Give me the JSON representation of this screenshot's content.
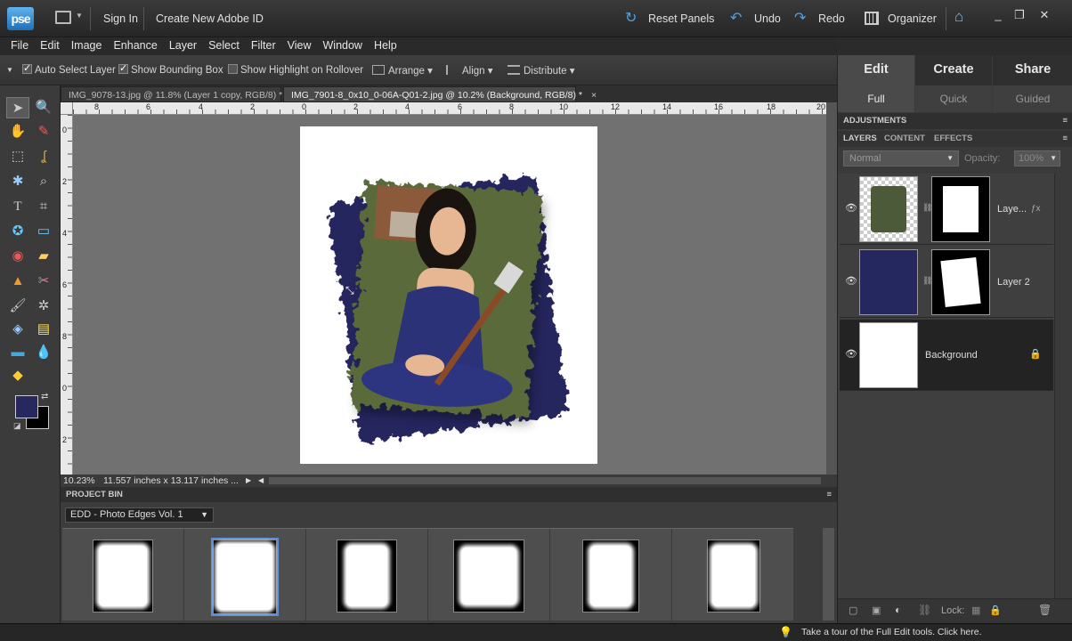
{
  "app": {
    "logo": "pse",
    "sign_in": "Sign In",
    "create_id": "Create New Adobe ID",
    "reset_panels": "Reset Panels",
    "undo": "Undo",
    "redo": "Redo",
    "organizer": "Organizer"
  },
  "menu": [
    "File",
    "Edit",
    "Image",
    "Enhance",
    "Layer",
    "Select",
    "Filter",
    "View",
    "Window",
    "Help"
  ],
  "options": {
    "auto_select": "Auto Select Layer",
    "bounding_box": "Show Bounding Box",
    "highlight": "Show Highlight on Rollover",
    "arrange": "Arrange",
    "align": "Align",
    "distribute": "Distribute"
  },
  "tabs": [
    {
      "label": "IMG_9078-13.jpg @ 11.8% (Layer 1 copy, RGB/8) *",
      "close": "×"
    },
    {
      "label": "IMG_7901-8_0x10_0-06A-Q01-2.jpg @ 10.2% (Background, RGB/8) *",
      "close": "×"
    }
  ],
  "ruler_top": [
    "8",
    "6",
    "4",
    "2",
    "0",
    "2",
    "4",
    "6",
    "8",
    "10",
    "12",
    "14",
    "16",
    "18",
    "20"
  ],
  "ruler_left": [
    "0",
    "2",
    "4",
    "6",
    "8",
    "0",
    "2"
  ],
  "status": {
    "zoom": "10.23%",
    "size": "11.557 inches x 13.117 inches ..."
  },
  "bin": {
    "header": "PROJECT BIN",
    "selected": "EDD - Photo Edges Vol. 1"
  },
  "right_panel": {
    "modes": [
      "Edit",
      "Create",
      "Share"
    ],
    "sub_modes": [
      "Full",
      "Quick",
      "Guided"
    ],
    "adjustments": "ADJUSTMENTS",
    "panel_tabs": [
      "LAYERS",
      "CONTENT",
      "EFFECTS"
    ],
    "blend_mode": "Normal",
    "opacity_label": "Opacity:",
    "opacity_value": "100%",
    "layers": [
      "Laye...",
      "Layer 2",
      "Background"
    ],
    "lock_label": "Lock:"
  },
  "tip": "Take a tour of the Full Edit tools. Click here.",
  "colors": {
    "foreground": "#27295e",
    "background": "#000000",
    "navy_fill": "#25275f"
  }
}
